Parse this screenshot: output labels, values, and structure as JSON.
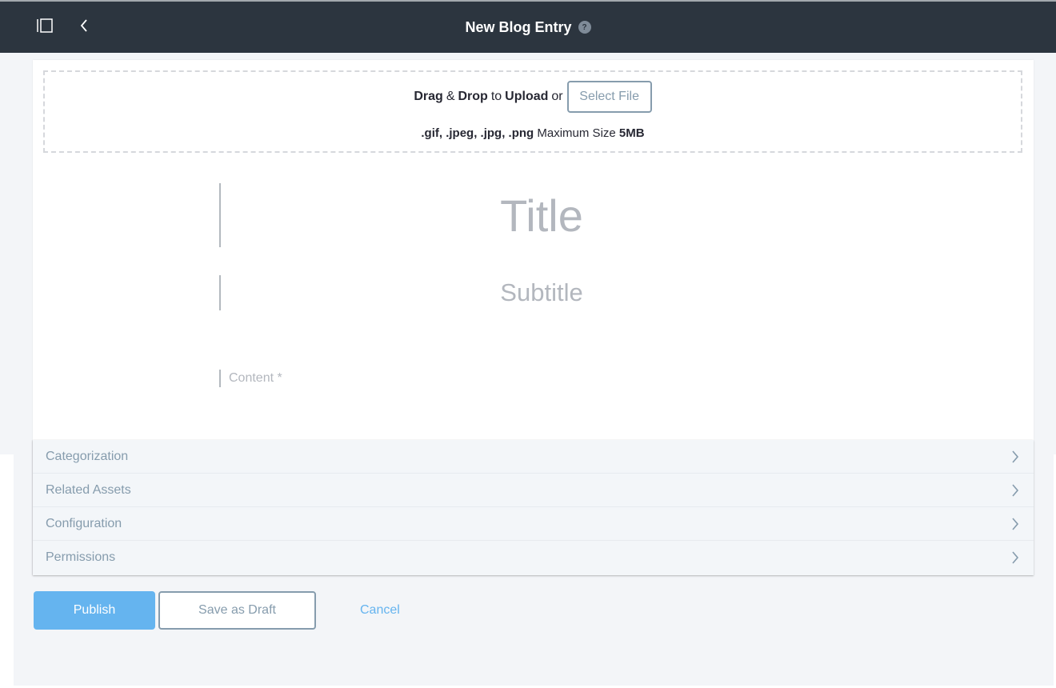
{
  "header": {
    "title": "New Blog Entry",
    "help_icon": "question-circle-icon",
    "sidebar_toggle_icon": "sidebar-toggle-icon",
    "back_icon": "chevron-left-icon"
  },
  "upload": {
    "drag": "Drag",
    "amp": "&",
    "drop": "Drop",
    "to": "to",
    "upload": "Upload",
    "or": "or",
    "select_file_label": "Select File",
    "formats": ".gif, .jpeg, .jpg, .png",
    "max_size_label": "Maximum Size",
    "max_size_value": "5MB"
  },
  "editor": {
    "title_placeholder": "Title",
    "title_value": "",
    "subtitle_placeholder": "Subtitle",
    "subtitle_value": "",
    "content_placeholder": "Content *",
    "content_value": ""
  },
  "panels": [
    {
      "label": "Categorization",
      "icon": "chevron-right-icon"
    },
    {
      "label": "Related Assets",
      "icon": "chevron-right-icon"
    },
    {
      "label": "Configuration",
      "icon": "chevron-right-icon"
    },
    {
      "label": "Permissions",
      "icon": "chevron-right-icon"
    }
  ],
  "actions": {
    "publish_label": "Publish",
    "draft_label": "Save as Draft",
    "cancel_label": "Cancel"
  },
  "colors": {
    "navbar": "#2c353f",
    "primary": "#65b4ef",
    "secondary": "#869cad",
    "background": "#f3f5f8"
  }
}
